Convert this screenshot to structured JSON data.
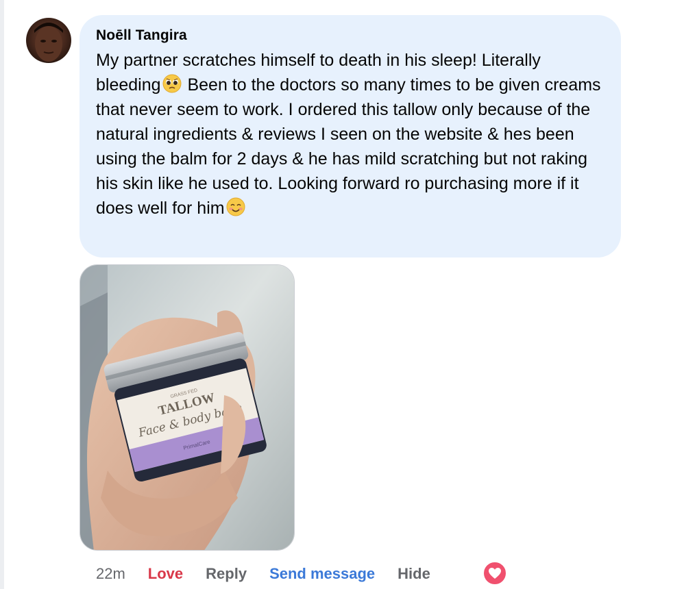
{
  "comment": {
    "author": "Noēll Tangira",
    "text_segments": [
      "My partner scratches himself to death in his sleep! Literally bleeding",
      " Been to the doctors so many times to be given creams that never seem to work. I ordered this tallow only because of the natural ingredients & reviews I seen on the website & hes been using the balm for 2 days & he has mild scratching but not raking his skin like he used to. Looking forward ro purchasing more if it does well for him"
    ],
    "emojis": [
      "pleading-face-emoji",
      "smiling-face-emoji"
    ],
    "bubble_color": "#e7f1fd"
  },
  "photo": {
    "jar_label": {
      "top": "GRASS FED",
      "title": "TALLOW",
      "script": "Face & body balm",
      "brand": "PrimalCare"
    }
  },
  "actions": {
    "timestamp": "22m",
    "love": "Love",
    "reply": "Reply",
    "send_message": "Send message",
    "hide": "Hide"
  },
  "reaction": {
    "icon": "heart-icon",
    "color": "#f0506e"
  },
  "colors": {
    "love": "#d93849",
    "link": "#3b79d8",
    "meta": "#65676b"
  }
}
